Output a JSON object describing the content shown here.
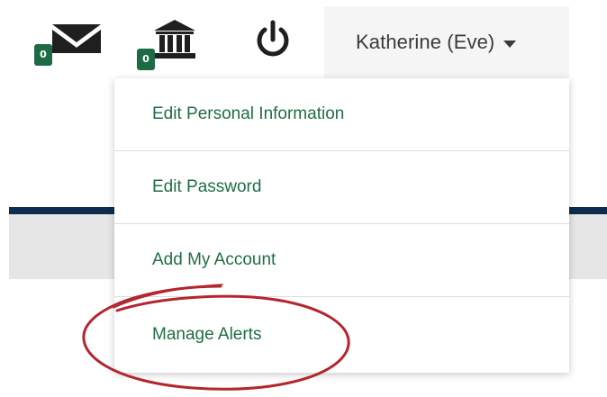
{
  "header": {
    "mail_count": "0",
    "bank_count": "0",
    "user_name": "Katherine (Eve)"
  },
  "icons": {
    "mail": "envelope-icon",
    "bank": "bank-icon",
    "power": "power-icon",
    "caret": "caret-down-icon"
  },
  "menu": {
    "items": [
      {
        "label": "Edit Personal Information"
      },
      {
        "label": "Edit Password"
      },
      {
        "label": "Add My Account"
      },
      {
        "label": "Manage Alerts"
      }
    ]
  },
  "colors": {
    "link_green": "#1f6f44",
    "badge_green": "#1d6b45",
    "navy": "#0c2d4f",
    "annotation_red": "#b3262e"
  }
}
